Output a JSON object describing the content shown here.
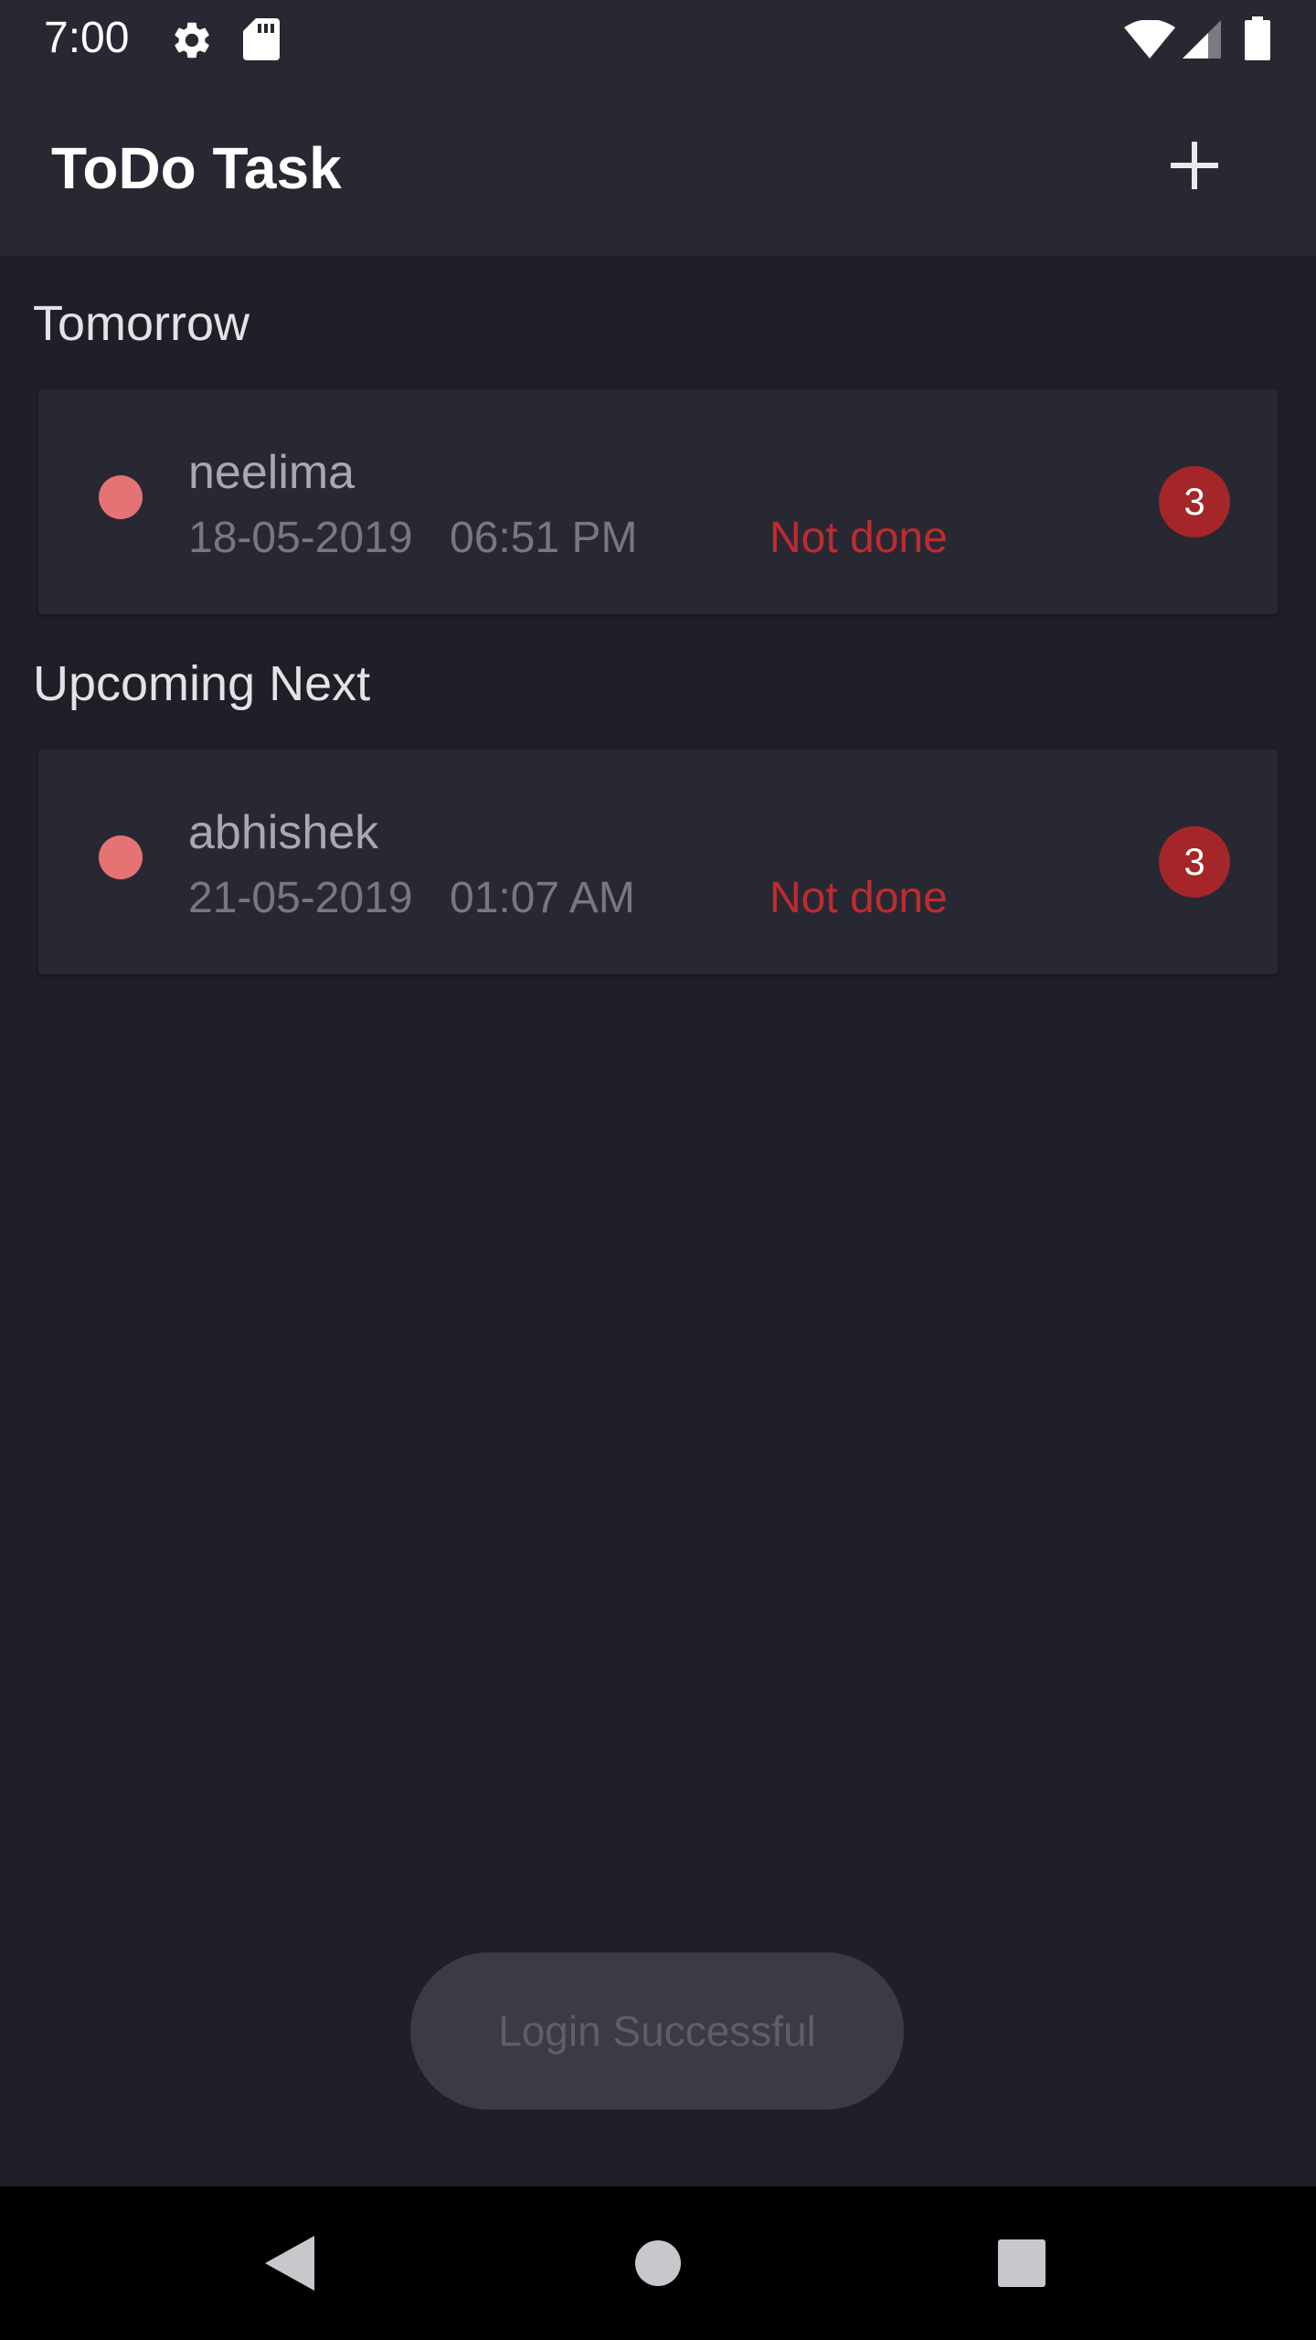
{
  "status_bar": {
    "time": "7:00",
    "icons": [
      "gear-icon",
      "sd-card-icon",
      "wifi-icon",
      "signal-icon",
      "battery-icon"
    ]
  },
  "app_bar": {
    "title": "ToDo Task",
    "action_icon": "plus-icon"
  },
  "sections": [
    {
      "header": "Tomorrow",
      "task": {
        "name": "neelima",
        "date": "18-05-2019",
        "time": "06:51 PM",
        "status": "Not done",
        "badge": "3"
      }
    },
    {
      "header": "Upcoming Next",
      "task": {
        "name": "abhishek",
        "date": "21-05-2019",
        "time": "01:07 AM",
        "status": "Not done",
        "badge": "3"
      }
    }
  ],
  "toast": {
    "message": "Login Successful"
  },
  "nav_bar": {
    "icons": [
      "back-icon",
      "home-icon",
      "recents-icon"
    ]
  },
  "colors": {
    "background": "#201f28",
    "surface": "#282833",
    "priority_dot": "#e57373",
    "status_not_done": "#bd2b30",
    "badge": "#a42628"
  }
}
